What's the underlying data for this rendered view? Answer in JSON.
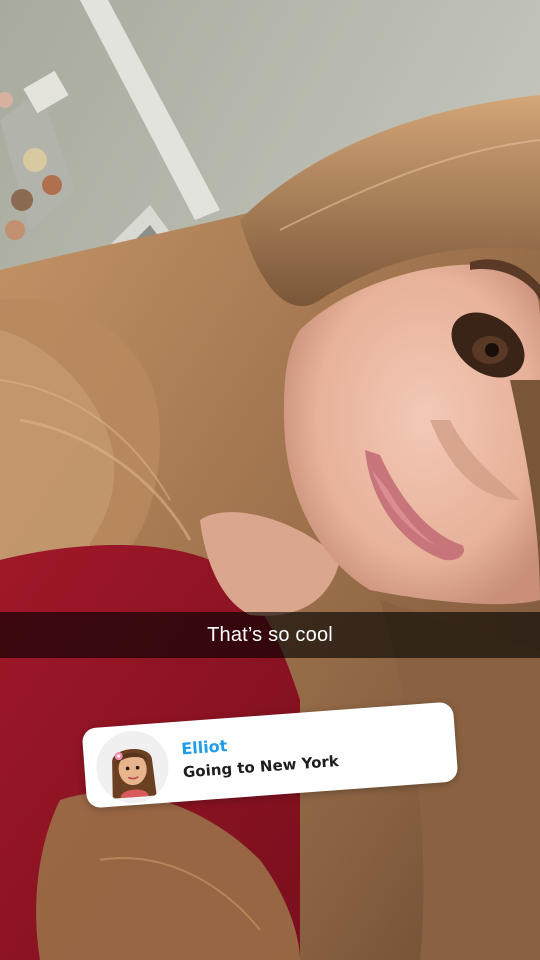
{
  "caption": {
    "text": "That’s so cool"
  },
  "status_card": {
    "name": "Elliot",
    "status": "Going to New York",
    "name_color": "#1f9de8"
  }
}
